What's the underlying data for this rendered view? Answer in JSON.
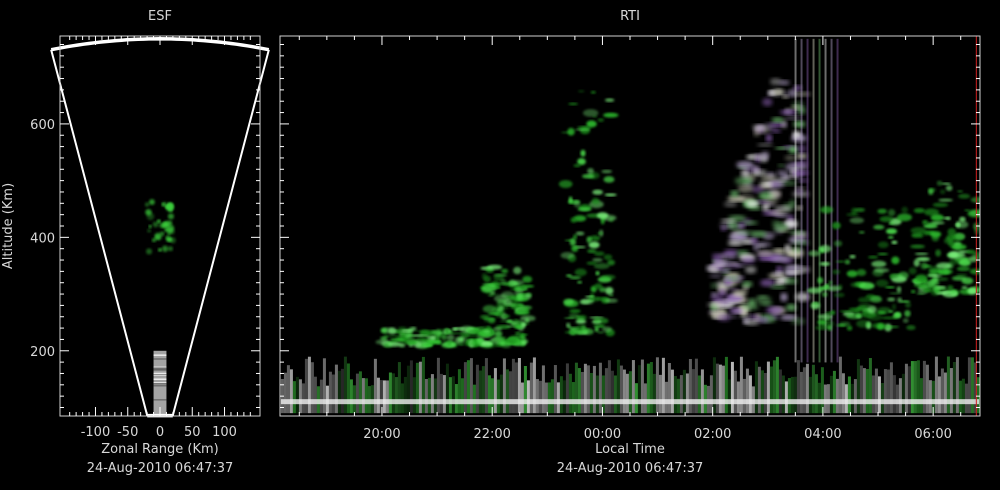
{
  "colors": {
    "background": "#000000",
    "frame": "#cfcfcf",
    "text": "#d8d8d8",
    "green": "#3cd23c",
    "white": "#f0f0f0",
    "purple": "#a070c0",
    "marker": "#d02020"
  },
  "chart_data": [
    {
      "type": "heatmap",
      "title": "ESF",
      "xlabel": "Zonal Range (Km)",
      "ylabel": "Altitude (Km)",
      "subtitle": "24-Aug-2010 06:47:37",
      "xlim": [
        -155,
        155
      ],
      "ylim": [
        85,
        755
      ],
      "x_ticks": [
        -100,
        -50,
        0,
        50,
        100
      ],
      "x_tick_labels": [
        "-100",
        "-50",
        "0",
        "50",
        "100"
      ],
      "y_ticks": [
        200,
        400,
        600
      ],
      "y_tick_labels": [
        "200",
        "400",
        "600"
      ],
      "fan_beam": {
        "inner_radius_km": 88,
        "outer_radius_km": 750,
        "half_angle_deg": 13
      },
      "echo_regions": [
        {
          "zonal_center_km": 0,
          "altitude_km": 420,
          "extent_km": 40,
          "color": "green"
        },
        {
          "zonal_center_km": 0,
          "altitude_km": 150,
          "extent_km": 60,
          "color": "white"
        }
      ]
    },
    {
      "type": "heatmap",
      "title": "RTI",
      "xlabel": "Local Time",
      "subtitle": "24-Aug-2010 06:47:37",
      "x_range_hours": [
        18.15,
        30.85
      ],
      "ylim": [
        85,
        755
      ],
      "x_ticks": [
        "20:00",
        "22:00",
        "00:00",
        "02:00",
        "04:00",
        "06:00"
      ],
      "y_ticks": [
        200,
        400,
        600
      ],
      "current_time_marker": "06:47",
      "echo_regions": [
        {
          "start": "18:10",
          "end": "06:50",
          "altitude_low": 90,
          "altitude_high": 190,
          "color": "white/green"
        },
        {
          "start": "20:00",
          "end": "22:00",
          "altitude_low": 210,
          "altitude_high": 240,
          "color": "green"
        },
        {
          "start": "21:50",
          "end": "22:40",
          "altitude_low": 210,
          "altitude_high": 350,
          "color": "green"
        },
        {
          "start": "23:20",
          "end": "00:10",
          "altitude_low": 230,
          "altitude_high": 660,
          "color": "green"
        },
        {
          "start": "02:00",
          "end": "03:40",
          "altitude_low": 250,
          "altitude_high": 700,
          "color": "white/purple"
        },
        {
          "start": "03:50",
          "end": "05:40",
          "altitude_low": 240,
          "altitude_high": 450,
          "color": "green"
        },
        {
          "start": "05:40",
          "end": "06:50",
          "altitude_low": 300,
          "altitude_high": 500,
          "color": "green"
        }
      ]
    }
  ]
}
